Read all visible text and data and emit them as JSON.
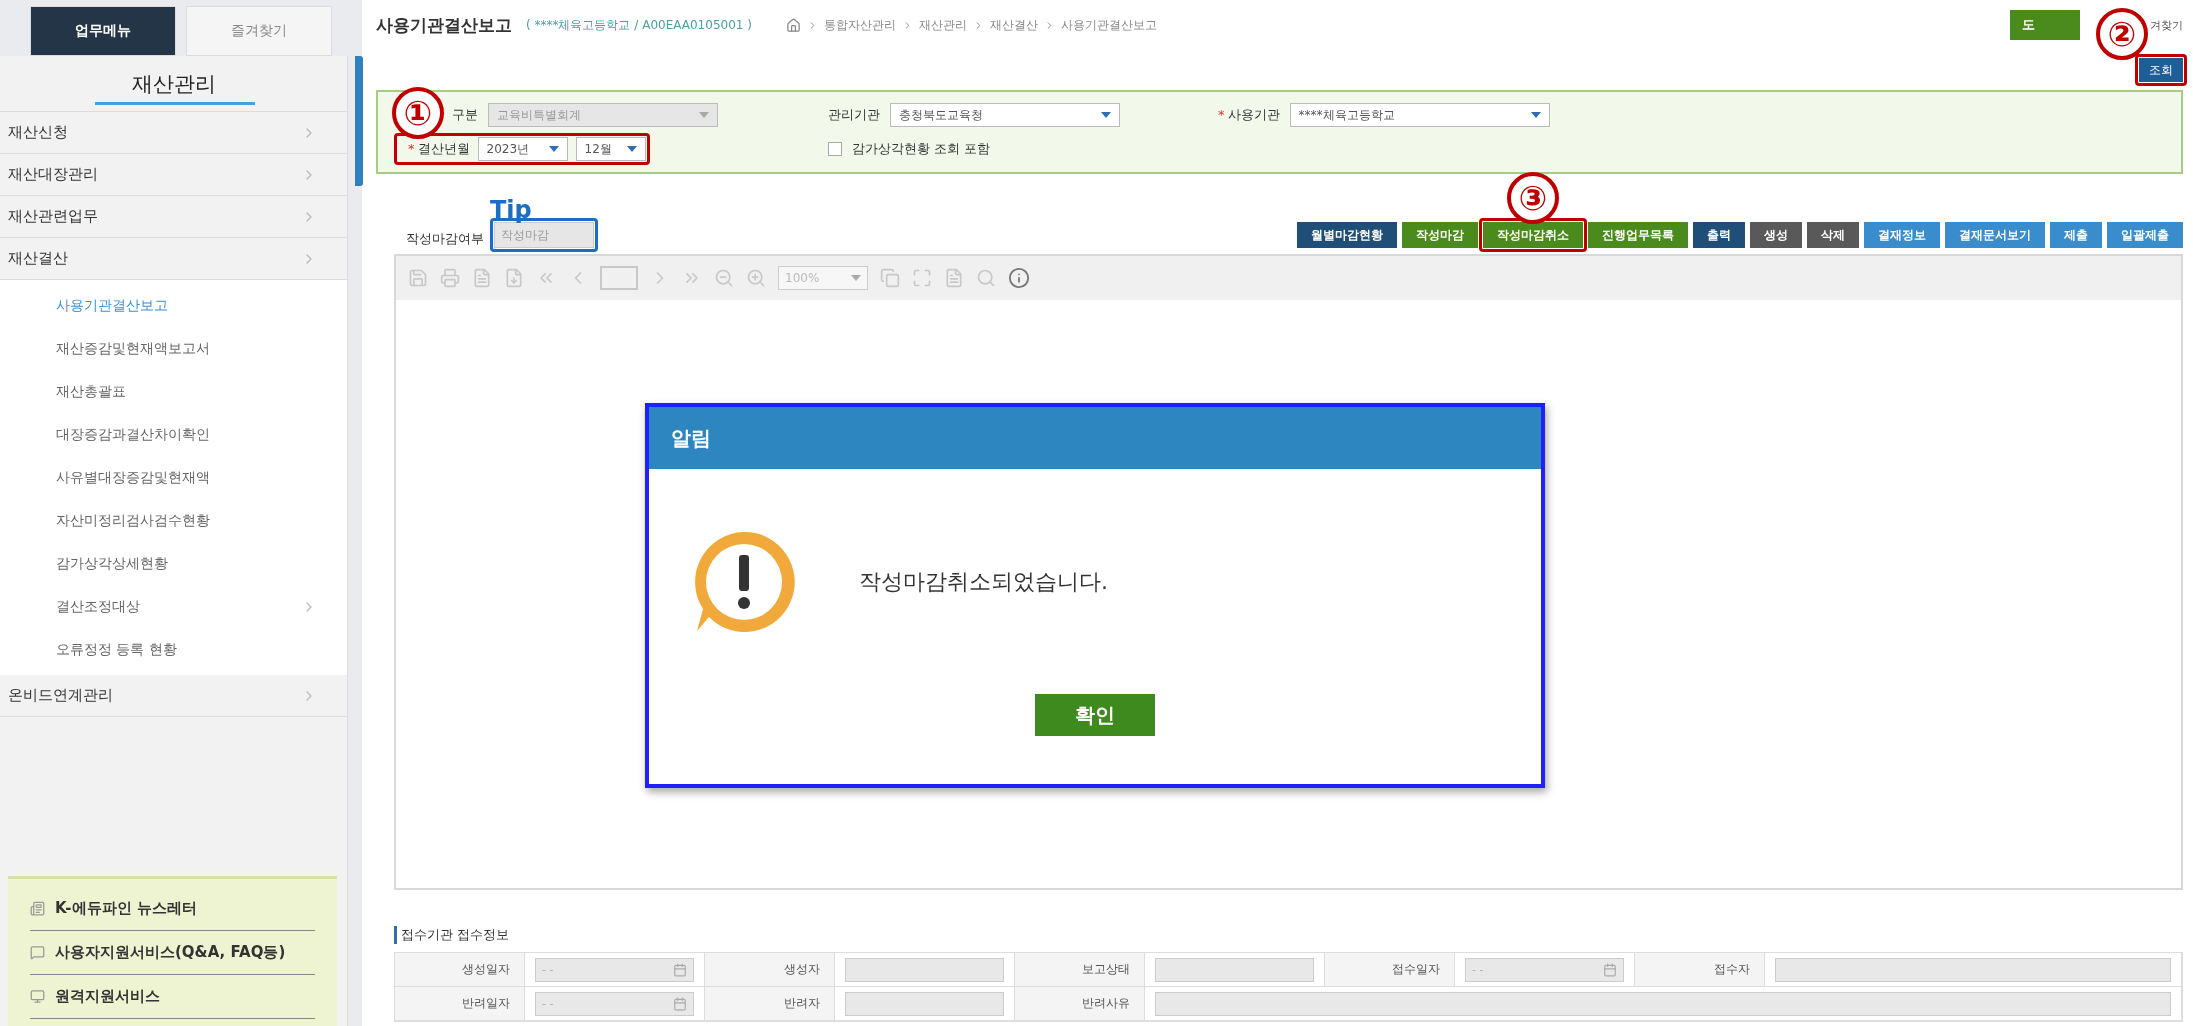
{
  "tabs": [
    {
      "label": "업무메뉴",
      "selected": true
    },
    {
      "label": "즐겨찾기",
      "selected": false
    }
  ],
  "sidebar": {
    "title": "재산관리",
    "items": [
      {
        "label": "재산신청",
        "kind": "folder"
      },
      {
        "label": "재산대장관리",
        "kind": "folder"
      },
      {
        "label": "재산관련업무",
        "kind": "folder"
      },
      {
        "label": "재산결산",
        "kind": "folder",
        "children": [
          {
            "label": "사용기관결산보고",
            "kind": "page",
            "selected": true
          },
          {
            "label": "재산증감및현재액보고서",
            "kind": "page",
            "selected": false
          },
          {
            "label": "재산총괄표",
            "kind": "page",
            "selected": false
          },
          {
            "label": "대장증감과결산차이확인",
            "kind": "page",
            "selected": false
          },
          {
            "label": "사유별대장증감및현재액",
            "kind": "page",
            "selected": false
          },
          {
            "label": "자산미정리검사검수현황",
            "kind": "page",
            "selected": false
          },
          {
            "label": "감가상각상세현황",
            "kind": "page",
            "selected": false
          },
          {
            "label": "결산조정대상",
            "kind": "folder",
            "selected": false
          },
          {
            "label": "오류정정 등록 현황",
            "kind": "page",
            "selected": false
          }
        ]
      },
      {
        "label": "온비드연계관리",
        "kind": "folder"
      }
    ]
  },
  "links": [
    "K-에듀파인 뉴스레터",
    "사용자지원서비스(Q&A, FAQ등)",
    "원격지원서비스"
  ],
  "header": {
    "title": "사용기관결산보고",
    "org_info": "( ****체육고등학교 / A00EAA0105001 )",
    "breadcrumb": [
      "통합자산관리",
      "재산관리",
      "재산결산",
      "사용기관결산보고"
    ],
    "help_button": "도",
    "favorites_link": "겨찾기",
    "search_button": {
      "label": "조회",
      "highlighted": true,
      "annotation": "②"
    }
  },
  "filters": {
    "row1": [
      {
        "label": "구분",
        "value": "교육비특별회계",
        "disabled": true
      },
      {
        "label": "관리기관",
        "value": "충청북도교육청",
        "disabled": false
      },
      {
        "mark": "*",
        "label": "사용기관",
        "value": "****체육고등학교",
        "disabled": false
      }
    ],
    "period": {
      "mark": "*",
      "label": "결산년월",
      "year": "2023년",
      "month": "12월",
      "highlighted": true,
      "annotation": "①"
    },
    "checkbox": {
      "label": "감가상각현황 조회 포함",
      "checked": false
    }
  },
  "status": {
    "label": "작성마감여부",
    "value": "작성마감",
    "highlighted": true,
    "annotation": "Tip"
  },
  "actions": [
    {
      "label": "월별마감현황",
      "color": "#1f4e79"
    },
    {
      "label": "작성마감",
      "color": "#4b8b1d"
    },
    {
      "label": "작성마감취소",
      "color": "#4b8b1d",
      "highlighted": true,
      "annotation": "③"
    },
    {
      "label": "진행업무목록",
      "color": "#4b8b1d"
    },
    {
      "label": "출력",
      "color": "#1f4e79"
    },
    {
      "label": "생성",
      "color": "#595959"
    },
    {
      "label": "삭제",
      "color": "#595959"
    },
    {
      "label": "결재정보",
      "color": "#3a8dcc"
    },
    {
      "label": "결재문서보기",
      "color": "#3a8dcc"
    },
    {
      "label": "제출",
      "color": "#3a8dcc"
    },
    {
      "label": "일괄제출",
      "color": "#3a8dcc"
    }
  ],
  "viewer": {
    "zoom": "100%"
  },
  "dialog": {
    "title": "알림",
    "message": "작성마감취소되었습니다.",
    "button": "확인",
    "highlighted": true
  },
  "receipt": {
    "title": "접수기관 접수정보",
    "rows": [
      [
        {
          "kind": "label",
          "text": "생성일자"
        },
        {
          "kind": "date",
          "placeholder": "- -"
        },
        {
          "kind": "label",
          "text": "생성자"
        },
        {
          "kind": "input"
        },
        {
          "kind": "label",
          "text": "보고상태"
        },
        {
          "kind": "input"
        },
        {
          "kind": "label",
          "text": "접수일자"
        },
        {
          "kind": "date",
          "placeholder": "- -"
        },
        {
          "kind": "label",
          "text": "접수자"
        },
        {
          "kind": "wide"
        }
      ],
      [
        {
          "kind": "label",
          "text": "반려일자"
        },
        {
          "kind": "date",
          "placeholder": "- -"
        },
        {
          "kind": "label",
          "text": "반려자"
        },
        {
          "kind": "input"
        },
        {
          "kind": "label",
          "text": "반려사유"
        },
        {
          "kind": "wide"
        }
      ]
    ]
  }
}
